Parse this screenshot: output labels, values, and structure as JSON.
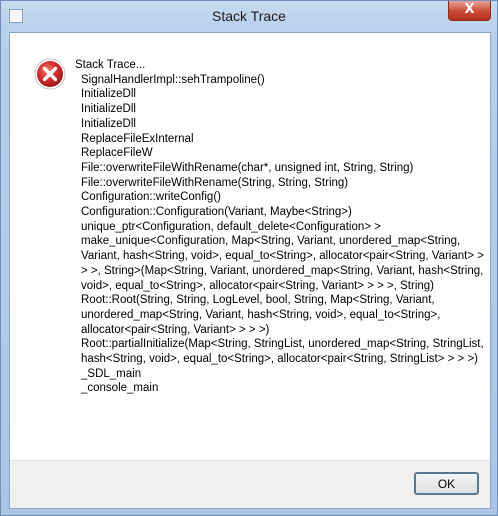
{
  "window": {
    "title": "Stack Trace",
    "close_glyph": "X"
  },
  "icon": {
    "name": "error-icon",
    "color": "#d32e2e"
  },
  "message": {
    "heading": "Stack Trace...",
    "frames": [
      "SignalHandlerImpl::sehTrampoline()",
      "InitializeDll",
      "InitializeDll",
      "InitializeDll",
      "ReplaceFileExInternal",
      "ReplaceFileW",
      "File::overwriteFileWithRename(char*, unsigned int, String, String)",
      "File::overwriteFileWithRename(String, String, String)",
      "Configuration::writeConfig()",
      "Configuration::Configuration(Variant, Maybe<String>)",
      "unique_ptr<Configuration, default_delete<Configuration> > make_unique<Configuration, Map<String, Variant, unordered_map<String, Variant, hash<String, void>, equal_to<String>, allocator<pair<String, Variant> > > >, String>(Map<String, Variant, unordered_map<String, Variant, hash<String, void>, equal_to<String>, allocator<pair<String, Variant> > > >, String)",
      "Root::Root(String, String, LogLevel, bool, String, Map<String, Variant, unordered_map<String, Variant, hash<String, void>, equal_to<String>, allocator<pair<String, Variant> > > >)",
      "Root::partialInitialize(Map<String, StringList, unordered_map<String, StringList, hash<String, void>, equal_to<String>, allocator<pair<String, StringList> > > >)",
      "_SDL_main",
      "_console_main"
    ]
  },
  "buttons": {
    "ok_label": "OK"
  }
}
